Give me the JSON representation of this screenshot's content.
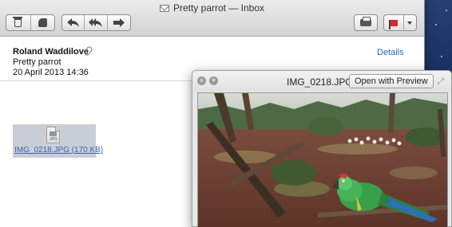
{
  "mail": {
    "window_title": "Pretty parrot — Inbox",
    "from": "Roland Waddilove",
    "subject": "Pretty parrot",
    "date": "20 April 2013 14:36",
    "details_link": "Details",
    "attachment_label": "IMG_0218.JPG (170 KB)",
    "attachment_file_type": "JPG",
    "toolbar_icons": [
      "trash-icon",
      "junk-icon",
      "reply-icon",
      "reply-all-icon",
      "forward-icon",
      "printer-icon",
      "flag-icon",
      "chevron-down-icon"
    ],
    "colors": {
      "link": "#2a64c8",
      "flag": "#e0272a"
    }
  },
  "quicklook": {
    "filename": "IMG_0218.JPG",
    "open_button": "Open with Preview"
  }
}
